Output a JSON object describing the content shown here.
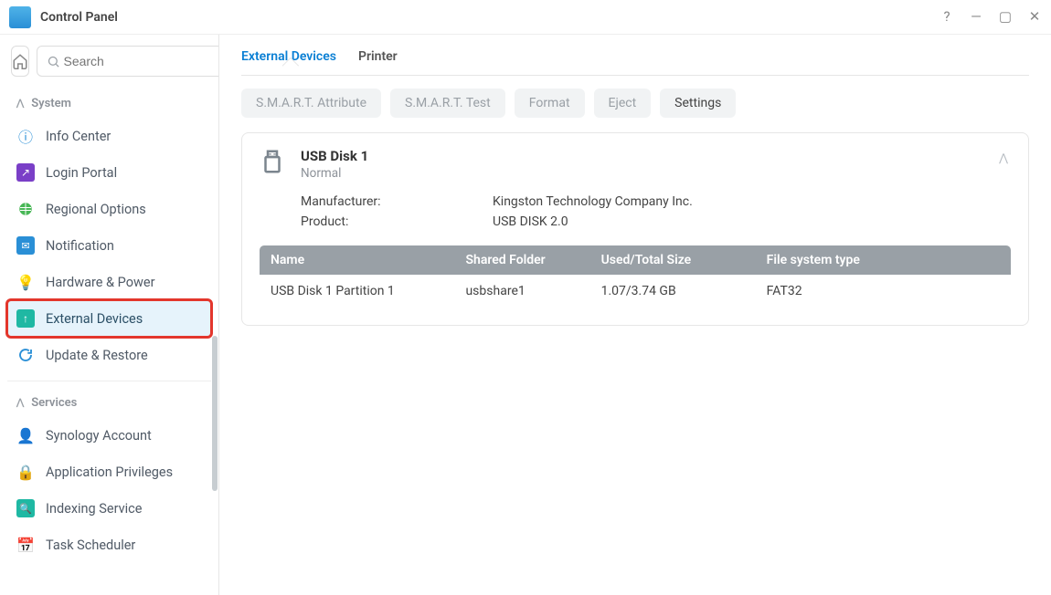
{
  "window": {
    "title": "Control Panel"
  },
  "search": {
    "placeholder": "Search"
  },
  "sidebar": {
    "groups": [
      {
        "label": "System",
        "items": [
          {
            "label": "Info Center"
          },
          {
            "label": "Login Portal"
          },
          {
            "label": "Regional Options"
          },
          {
            "label": "Notification"
          },
          {
            "label": "Hardware & Power"
          },
          {
            "label": "External Devices"
          },
          {
            "label": "Update & Restore"
          }
        ]
      },
      {
        "label": "Services",
        "items": [
          {
            "label": "Synology Account"
          },
          {
            "label": "Application Privileges"
          },
          {
            "label": "Indexing Service"
          },
          {
            "label": "Task Scheduler"
          }
        ]
      }
    ]
  },
  "tabs": [
    {
      "label": "External Devices"
    },
    {
      "label": "Printer"
    }
  ],
  "toolbar": {
    "smart_attr": "S.M.A.R.T. Attribute",
    "smart_test": "S.M.A.R.T. Test",
    "format": "Format",
    "eject": "Eject",
    "settings": "Settings"
  },
  "device": {
    "title": "USB Disk 1",
    "status": "Normal",
    "manufacturer_label": "Manufacturer:",
    "manufacturer_value": "Kingston Technology Company Inc.",
    "product_label": "Product:",
    "product_value": "USB DISK 2.0",
    "table": {
      "headers": {
        "name": "Name",
        "shared": "Shared Folder",
        "size": "Used/Total Size",
        "fs": "File system type"
      },
      "rows": [
        {
          "name": "USB Disk 1 Partition 1",
          "shared": "usbshare1",
          "size": "1.07/3.74 GB",
          "fs": "FAT32"
        }
      ]
    }
  }
}
